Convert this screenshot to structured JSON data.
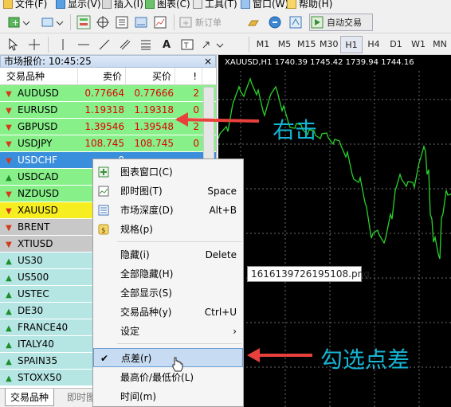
{
  "menubar": {
    "items": [
      {
        "label": "文件(F)",
        "icon": "file-icon"
      },
      {
        "label": "显示(V)",
        "icon": "view-icon"
      },
      {
        "label": "插入(I)",
        "icon": "insert-icon"
      },
      {
        "label": "图表(C)",
        "icon": "chart-icon"
      },
      {
        "label": "工具(T)",
        "icon": "tools-icon"
      },
      {
        "label": "窗口(W)",
        "icon": "window-icon"
      },
      {
        "label": "帮助(H)",
        "icon": "help-icon"
      }
    ]
  },
  "toolbar1": {
    "new_order": "新订单",
    "auto_trading": "自动交易"
  },
  "toolbar2": {
    "timeframes": [
      "M1",
      "M5",
      "M15",
      "M30",
      "H1",
      "H4",
      "D1",
      "W1",
      "MN"
    ],
    "selected": "H1"
  },
  "market_watch": {
    "title": "市场报价: 10:45:25",
    "close": "×",
    "headers": {
      "symbol": "交易品种",
      "bid": "卖价",
      "ask": "买价",
      "spread": "!"
    },
    "rows": [
      {
        "symbol": "AUDUSD",
        "bid": "0.77664",
        "ask": "0.77666",
        "spread": "2",
        "dir": "down",
        "bg": "green"
      },
      {
        "symbol": "EURUSD",
        "bid": "1.19318",
        "ask": "1.19318",
        "spread": "0",
        "dir": "down",
        "bg": "green"
      },
      {
        "symbol": "GBPUSD",
        "bid": "1.39546",
        "ask": "1.39548",
        "spread": "2",
        "dir": "down",
        "bg": "green"
      },
      {
        "symbol": "USDJPY",
        "bid": "108.745",
        "ask": "108.745",
        "spread": "0",
        "dir": "down",
        "bg": "green"
      },
      {
        "symbol": "USDCHF",
        "bid": "0",
        "ask": "",
        "spread": "",
        "dir": "down",
        "bg": "blue"
      },
      {
        "symbol": "USDCAD",
        "bid": "1",
        "ask": "",
        "spread": "",
        "dir": "up",
        "bg": "green"
      },
      {
        "symbol": "NZDUSD",
        "bid": "0",
        "ask": "",
        "spread": "",
        "dir": "down",
        "bg": "green"
      },
      {
        "symbol": "XAUUSD",
        "bid": "1",
        "ask": "",
        "spread": "",
        "dir": "down",
        "bg": "yellow"
      },
      {
        "symbol": "BRENT",
        "bid": "",
        "ask": "",
        "spread": "",
        "dir": "down",
        "bg": "gray"
      },
      {
        "symbol": "XTIUSD",
        "bid": "",
        "ask": "",
        "spread": "",
        "dir": "down",
        "bg": "gray"
      },
      {
        "symbol": "US30",
        "bid": "32",
        "ask": "",
        "spread": "",
        "dir": "up",
        "bg": "aqua"
      },
      {
        "symbol": "US500",
        "bid": "3",
        "ask": "",
        "spread": "",
        "dir": "up",
        "bg": "aqua"
      },
      {
        "symbol": "USTEC",
        "bid": "12",
        "ask": "",
        "spread": "",
        "dir": "up",
        "bg": "aqua"
      },
      {
        "symbol": "DE30",
        "bid": "14",
        "ask": "",
        "spread": "",
        "dir": "up",
        "bg": "aqua"
      },
      {
        "symbol": "FRANCE40",
        "bid": "6",
        "ask": "",
        "spread": "",
        "dir": "up",
        "bg": "aqua"
      },
      {
        "symbol": "ITALY40",
        "bid": "24",
        "ask": "",
        "spread": "",
        "dir": "up",
        "bg": "aqua"
      },
      {
        "symbol": "SPAIN35",
        "bid": "8",
        "ask": "",
        "spread": "",
        "dir": "up",
        "bg": "aqua"
      },
      {
        "symbol": "STOXX50",
        "bid": "",
        "ask": "",
        "spread": "",
        "dir": "up",
        "bg": "aqua"
      }
    ],
    "tabs": [
      "交易品种",
      "即时图"
    ]
  },
  "chart": {
    "info": "XAUUSD,H1  1740.39 1745.42 1739.94 1744.16",
    "colors": {
      "background": "#000000",
      "line": "#2ad12a",
      "grid": "#6e6e6e"
    }
  },
  "context_menu": {
    "items": [
      {
        "label": "图表窗口(C)",
        "shortcut": "",
        "icon": "chart-window-icon"
      },
      {
        "label": "即时图(T)",
        "shortcut": "Space",
        "icon": "tick-chart-icon"
      },
      {
        "label": "市场深度(D)",
        "shortcut": "Alt+B",
        "icon": "depth-icon"
      },
      {
        "label": "规格(p)",
        "shortcut": "",
        "icon": "spec-icon"
      },
      {
        "label": "隐藏(i)",
        "shortcut": "Delete",
        "icon": ""
      },
      {
        "label": "全部隐藏(H)",
        "shortcut": "",
        "icon": ""
      },
      {
        "label": "全部显示(S)",
        "shortcut": "",
        "icon": ""
      },
      {
        "label": "交易品种(y)",
        "shortcut": "Ctrl+U",
        "icon": ""
      },
      {
        "label": "设定",
        "shortcut": "›",
        "icon": ""
      },
      {
        "label": "点差(r)",
        "shortcut": "",
        "icon": "",
        "checked": true
      },
      {
        "label": "最高价/最低价(L)",
        "shortcut": "",
        "icon": ""
      },
      {
        "label": "时间(m)",
        "shortcut": "",
        "icon": ""
      }
    ]
  },
  "tooltip": "1616139726195108.png",
  "annotations": {
    "right_click": "右击",
    "check_spread": "勾选点差",
    "arrow_color": "#e8403a",
    "text_color": "#14b4d4"
  }
}
